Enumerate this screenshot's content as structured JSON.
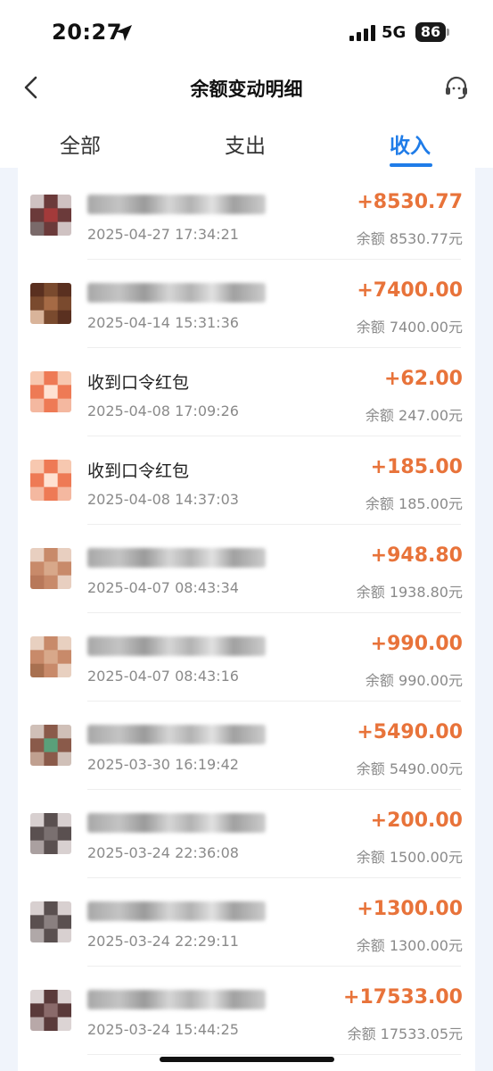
{
  "status_bar": {
    "time": "20:27",
    "network": "5G",
    "battery": "86"
  },
  "header": {
    "title": "余额变动明细"
  },
  "tabs": [
    {
      "label": "全部",
      "active": false
    },
    {
      "label": "支出",
      "active": false
    },
    {
      "label": "收入",
      "active": true
    }
  ],
  "balance_prefix": "余额",
  "currency_suffix": "元",
  "transactions": [
    {
      "title": "",
      "time": "2025-04-27 17:34:21",
      "amount": "+8530.77",
      "balance": "余额 8530.77元",
      "avatar": "blurred-photo"
    },
    {
      "title": "",
      "time": "2025-04-14 15:31:36",
      "amount": "+7400.00",
      "balance": "余额 7400.00元",
      "avatar": "blurred-photo"
    },
    {
      "title": "收到口令红包",
      "time": "2025-04-08 17:09:26",
      "amount": "+62.00",
      "balance": "余额 247.00元",
      "avatar": "red-packet"
    },
    {
      "title": "收到口令红包",
      "time": "2025-04-08 14:37:03",
      "amount": "+185.00",
      "balance": "余额 185.00元",
      "avatar": "red-packet"
    },
    {
      "title": "",
      "time": "2025-04-07 08:43:34",
      "amount": "+948.80",
      "balance": "余额 1938.80元",
      "avatar": "blurred-photo"
    },
    {
      "title": "",
      "time": "2025-04-07 08:43:16",
      "amount": "+990.00",
      "balance": "余额 990.00元",
      "avatar": "blurred-photo"
    },
    {
      "title": "",
      "time": "2025-03-30 16:19:42",
      "amount": "+5490.00",
      "balance": "余额 5490.00元",
      "avatar": "blurred-photo"
    },
    {
      "title": "",
      "time": "2025-03-24 22:36:08",
      "amount": "+200.00",
      "balance": "余额 1500.00元",
      "avatar": "blurred-photo"
    },
    {
      "title": "",
      "time": "2025-03-24 22:29:11",
      "amount": "+1300.00",
      "balance": "余额 1300.00元",
      "avatar": "blurred-photo"
    },
    {
      "title": "",
      "time": "2025-03-24 15:44:25",
      "amount": "+17533.00",
      "balance": "余额 17533.05元",
      "avatar": "blurred-photo"
    }
  ],
  "colors": {
    "accent": "#1f7ce8",
    "income": "#e8733a",
    "list_background": "#f0f4fb"
  }
}
